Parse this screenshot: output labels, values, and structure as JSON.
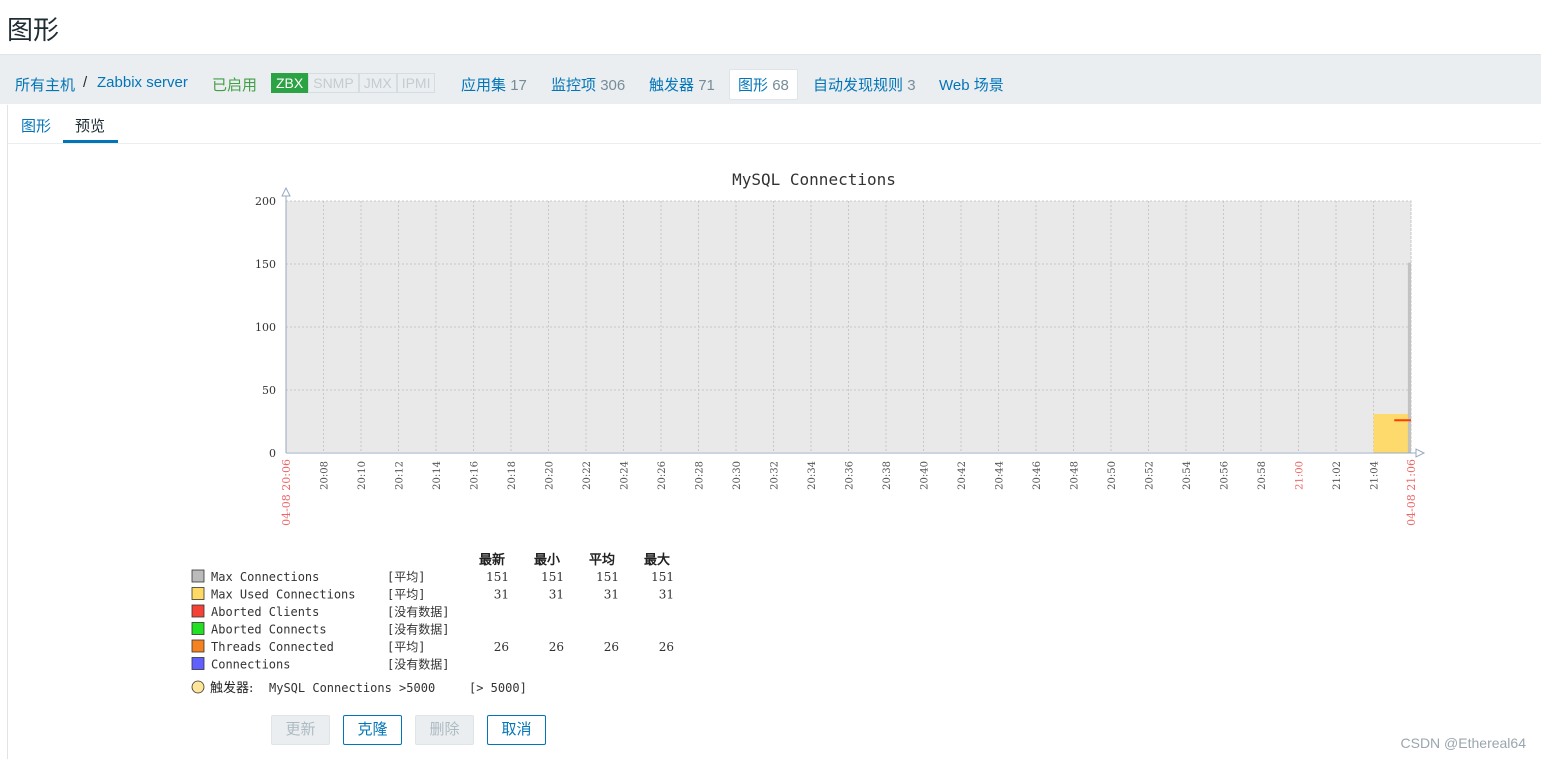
{
  "page": {
    "title": "图形"
  },
  "nav": {
    "all_hosts": "所有主机",
    "separator": "/",
    "host": "Zabbix server",
    "status": "已启用",
    "badges": [
      "ZBX",
      "SNMP",
      "JMX",
      "IPMI"
    ],
    "applications": {
      "label": "应用集",
      "count": "17"
    },
    "items": {
      "label": "监控项",
      "count": "306"
    },
    "triggers": {
      "label": "触发器",
      "count": "71"
    },
    "graphs": {
      "label": "图形",
      "count": "68"
    },
    "discovery": {
      "label": "自动发现规则",
      "count": "3"
    },
    "web": {
      "label": "Web 场景"
    }
  },
  "tabs": {
    "graph": "图形",
    "preview": "预览"
  },
  "chart_data": {
    "type": "area",
    "title": "MySQL Connections",
    "ylim": [
      0,
      200
    ],
    "yticks": [
      "200",
      "150",
      "100",
      "50",
      "0"
    ],
    "x_start_label": "04-08 20:06",
    "x_end_label": "04-08 21:06",
    "xticks": [
      "20:08",
      "20:10",
      "20:12",
      "20:14",
      "20:16",
      "20:18",
      "20:20",
      "20:22",
      "20:24",
      "20:26",
      "20:28",
      "20:30",
      "20:32",
      "20:34",
      "20:36",
      "20:38",
      "20:40",
      "20:42",
      "20:44",
      "20:46",
      "20:48",
      "20:50",
      "20:52",
      "20:54",
      "20:56",
      "20:58",
      "21:00",
      "21:02",
      "21:04"
    ],
    "series": [
      {
        "name": "Max Connections",
        "color": "#C0C0C0",
        "value": 151,
        "x_from": "21:05:50",
        "x_to": "21:06"
      },
      {
        "name": "Max Used Connections",
        "color": "#FFD966",
        "value": 31,
        "x_from": "21:04",
        "x_to": "21:06"
      },
      {
        "name": "Threads Connected",
        "color": "#F58220",
        "value": 26,
        "x_from": "21:05",
        "x_to": "21:06"
      }
    ],
    "legend_headers": [
      "最新",
      "最小",
      "平均",
      "最大"
    ],
    "legend": [
      {
        "name": "Max Connections",
        "func": "[平均]",
        "color": "#BBBBBB",
        "last": "151",
        "min": "151",
        "avg": "151",
        "max": "151"
      },
      {
        "name": "Max Used Connections",
        "func": "[平均]",
        "color": "#FFD966",
        "last": "31",
        "min": "31",
        "avg": "31",
        "max": "31"
      },
      {
        "name": "Aborted Clients",
        "func": "[没有数据]",
        "color": "#F44336",
        "last": "",
        "min": "",
        "avg": "",
        "max": ""
      },
      {
        "name": "Aborted Connects",
        "func": "[没有数据]",
        "color": "#22E022",
        "last": "",
        "min": "",
        "avg": "",
        "max": ""
      },
      {
        "name": "Threads Connected",
        "func": "[平均]",
        "color": "#F58220",
        "last": "26",
        "min": "26",
        "avg": "26",
        "max": "26"
      },
      {
        "name": "Connections",
        "func": "[没有数据]",
        "color": "#6060FF",
        "last": "",
        "min": "",
        "avg": "",
        "max": ""
      }
    ],
    "trigger": {
      "label": "触发器:",
      "text": "MySQL Connections >5000",
      "threshold": "[> 5000]",
      "color": "#FFE599"
    }
  },
  "buttons": {
    "update": "更新",
    "clone": "克隆",
    "delete": "删除",
    "cancel": "取消"
  },
  "watermark": "CSDN @Ethereal64"
}
